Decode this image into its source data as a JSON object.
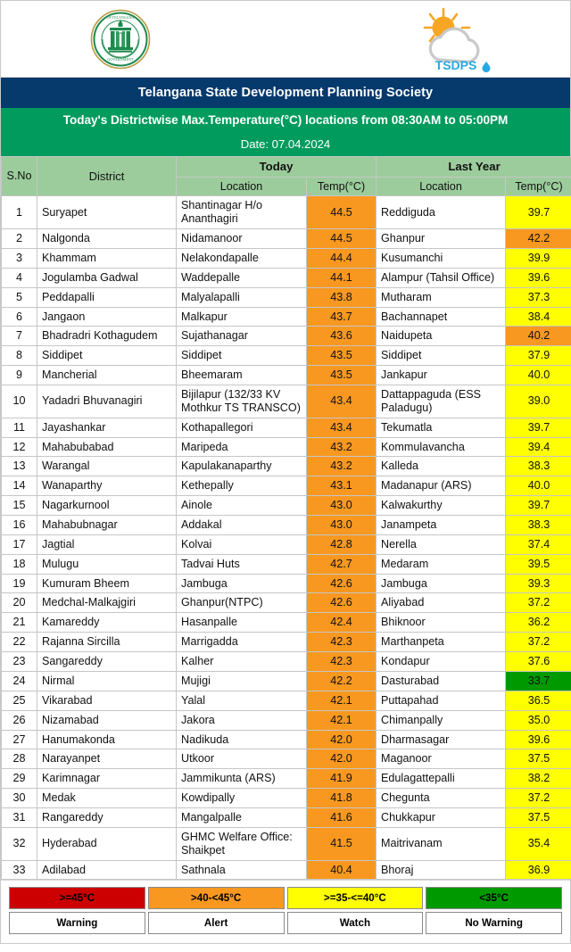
{
  "header": {
    "emblem_alt": "government-of-telangana-emblem",
    "logo_text": "TSDPS",
    "org_title": "Telangana State Development Planning Society",
    "subtitle": "Today's Districtwise Max.Temperature(°C) locations from 08:30AM to 05:00PM",
    "date_line": "Date: 07.04.2024"
  },
  "table": {
    "group_today": "Today",
    "group_last_year": "Last Year",
    "col_sno": "S.No",
    "col_district": "District",
    "col_location": "Location",
    "col_temp": "Temp(°C)",
    "col_location_ly": "Location",
    "col_temp_ly": "Temp(°C)",
    "rows": [
      {
        "sno": "1",
        "district": "Suryapet",
        "loc": "Shantinagar H/o Ananthagiri",
        "temp": "44.5",
        "sev": "alert",
        "loc_ly": "Reddiguda",
        "temp_ly": "39.7",
        "sev_ly": "watch"
      },
      {
        "sno": "2",
        "district": "Nalgonda",
        "loc": "Nidamanoor",
        "temp": "44.5",
        "sev": "alert",
        "loc_ly": "Ghanpur",
        "temp_ly": "42.2",
        "sev_ly": "alert"
      },
      {
        "sno": "3",
        "district": "Khammam",
        "loc": "Nelakondapalle",
        "temp": "44.4",
        "sev": "alert",
        "loc_ly": "Kusumanchi",
        "temp_ly": "39.9",
        "sev_ly": "watch"
      },
      {
        "sno": "4",
        "district": "Jogulamba Gadwal",
        "loc": "Waddepalle",
        "temp": "44.1",
        "sev": "alert",
        "loc_ly": "Alampur (Tahsil Office)",
        "temp_ly": "39.6",
        "sev_ly": "watch"
      },
      {
        "sno": "5",
        "district": "Peddapalli",
        "loc": "Malyalapalli",
        "temp": "43.8",
        "sev": "alert",
        "loc_ly": "Mutharam",
        "temp_ly": "37.3",
        "sev_ly": "watch"
      },
      {
        "sno": "6",
        "district": "Jangaon",
        "loc": "Malkapur",
        "temp": "43.7",
        "sev": "alert",
        "loc_ly": "Bachannapet",
        "temp_ly": "38.4",
        "sev_ly": "watch"
      },
      {
        "sno": "7",
        "district": "Bhadradri Kothagudem",
        "loc": "Sujathanagar",
        "temp": "43.6",
        "sev": "alert",
        "loc_ly": "Naidupeta",
        "temp_ly": "40.2",
        "sev_ly": "alert"
      },
      {
        "sno": "8",
        "district": "Siddipet",
        "loc": "Siddipet",
        "temp": "43.5",
        "sev": "alert",
        "loc_ly": "Siddipet",
        "temp_ly": "37.9",
        "sev_ly": "watch"
      },
      {
        "sno": "9",
        "district": "Mancherial",
        "loc": "Bheemaram",
        "temp": "43.5",
        "sev": "alert",
        "loc_ly": "Jankapur",
        "temp_ly": "40.0",
        "sev_ly": "watch"
      },
      {
        "sno": "10",
        "district": "Yadadri Bhuvanagiri",
        "loc": "Bijilapur (132/33 KV Mothkur TS TRANSCO)",
        "temp": "43.4",
        "sev": "alert",
        "loc_ly": "Dattappaguda (ESS Paladugu)",
        "temp_ly": "39.0",
        "sev_ly": "watch"
      },
      {
        "sno": "11",
        "district": "Jayashankar",
        "loc": "Kothapallegori",
        "temp": "43.4",
        "sev": "alert",
        "loc_ly": "Tekumatla",
        "temp_ly": "39.7",
        "sev_ly": "watch"
      },
      {
        "sno": "12",
        "district": "Mahabubabad",
        "loc": "Maripeda",
        "temp": "43.2",
        "sev": "alert",
        "loc_ly": "Kommulavancha",
        "temp_ly": "39.4",
        "sev_ly": "watch"
      },
      {
        "sno": "13",
        "district": "Warangal",
        "loc": "Kapulakanaparthy",
        "temp": "43.2",
        "sev": "alert",
        "loc_ly": "Kalleda",
        "temp_ly": "38.3",
        "sev_ly": "watch"
      },
      {
        "sno": "14",
        "district": "Wanaparthy",
        "loc": "Kethepally",
        "temp": "43.1",
        "sev": "alert",
        "loc_ly": "Madanapur (ARS)",
        "temp_ly": "40.0",
        "sev_ly": "watch"
      },
      {
        "sno": "15",
        "district": "Nagarkurnool",
        "loc": "Ainole",
        "temp": "43.0",
        "sev": "alert",
        "loc_ly": "Kalwakurthy",
        "temp_ly": "39.7",
        "sev_ly": "watch"
      },
      {
        "sno": "16",
        "district": "Mahabubnagar",
        "loc": "Addakal",
        "temp": "43.0",
        "sev": "alert",
        "loc_ly": "Janampeta",
        "temp_ly": "38.3",
        "sev_ly": "watch"
      },
      {
        "sno": "17",
        "district": "Jagtial",
        "loc": "Kolvai",
        "temp": "42.8",
        "sev": "alert",
        "loc_ly": "Nerella",
        "temp_ly": "37.4",
        "sev_ly": "watch"
      },
      {
        "sno": "18",
        "district": "Mulugu",
        "loc": "Tadvai Huts",
        "temp": "42.7",
        "sev": "alert",
        "loc_ly": "Medaram",
        "temp_ly": "39.5",
        "sev_ly": "watch"
      },
      {
        "sno": "19",
        "district": "Kumuram Bheem",
        "loc": "Jambuga",
        "temp": "42.6",
        "sev": "alert",
        "loc_ly": "Jambuga",
        "temp_ly": "39.3",
        "sev_ly": "watch"
      },
      {
        "sno": "20",
        "district": "Medchal-Malkajgiri",
        "loc": "Ghanpur(NTPC)",
        "temp": "42.6",
        "sev": "alert",
        "loc_ly": "Aliyabad",
        "temp_ly": "37.2",
        "sev_ly": "watch"
      },
      {
        "sno": "21",
        "district": "Kamareddy",
        "loc": "Hasanpalle",
        "temp": "42.4",
        "sev": "alert",
        "loc_ly": "Bhiknoor",
        "temp_ly": "36.2",
        "sev_ly": "watch"
      },
      {
        "sno": "22",
        "district": "Rajanna Sircilla",
        "loc": "Marrigadda",
        "temp": "42.3",
        "sev": "alert",
        "loc_ly": "Marthanpeta",
        "temp_ly": "37.2",
        "sev_ly": "watch"
      },
      {
        "sno": "23",
        "district": "Sangareddy",
        "loc": "Kalher",
        "temp": "42.3",
        "sev": "alert",
        "loc_ly": "Kondapur",
        "temp_ly": "37.6",
        "sev_ly": "watch"
      },
      {
        "sno": "24",
        "district": "Nirmal",
        "loc": "Mujigi",
        "temp": "42.2",
        "sev": "alert",
        "loc_ly": "Dasturabad",
        "temp_ly": "33.7",
        "sev_ly": "nowarning"
      },
      {
        "sno": "25",
        "district": "Vikarabad",
        "loc": "Yalal",
        "temp": "42.1",
        "sev": "alert",
        "loc_ly": "Puttapahad",
        "temp_ly": "36.5",
        "sev_ly": "watch"
      },
      {
        "sno": "26",
        "district": "Nizamabad",
        "loc": "Jakora",
        "temp": "42.1",
        "sev": "alert",
        "loc_ly": "Chimanpally",
        "temp_ly": "35.0",
        "sev_ly": "watch"
      },
      {
        "sno": "27",
        "district": "Hanumakonda",
        "loc": "Nadikuda",
        "temp": "42.0",
        "sev": "alert",
        "loc_ly": "Dharmasagar",
        "temp_ly": "39.6",
        "sev_ly": "watch"
      },
      {
        "sno": "28",
        "district": "Narayanpet",
        "loc": "Utkoor",
        "temp": "42.0",
        "sev": "alert",
        "loc_ly": "Maganoor",
        "temp_ly": "37.5",
        "sev_ly": "watch"
      },
      {
        "sno": "29",
        "district": "Karimnagar",
        "loc": "Jammikunta (ARS)",
        "temp": "41.9",
        "sev": "alert",
        "loc_ly": "Edulagattepalli",
        "temp_ly": "38.2",
        "sev_ly": "watch"
      },
      {
        "sno": "30",
        "district": "Medak",
        "loc": "Kowdipally",
        "temp": "41.8",
        "sev": "alert",
        "loc_ly": "Chegunta",
        "temp_ly": "37.2",
        "sev_ly": "watch"
      },
      {
        "sno": "31",
        "district": "Rangareddy",
        "loc": "Mangalpalle",
        "temp": "41.6",
        "sev": "alert",
        "loc_ly": "Chukkapur",
        "temp_ly": "37.5",
        "sev_ly": "watch"
      },
      {
        "sno": "32",
        "district": "Hyderabad",
        "loc": "GHMC Welfare Office: Shaikpet",
        "temp": "41.5",
        "sev": "alert",
        "loc_ly": "Maitrivanam",
        "temp_ly": "35.4",
        "sev_ly": "watch"
      },
      {
        "sno": "33",
        "district": "Adilabad",
        "loc": "Sathnala",
        "temp": "40.4",
        "sev": "alert",
        "loc_ly": "Bhoraj",
        "temp_ly": "36.9",
        "sev_ly": "watch"
      }
    ]
  },
  "legend": {
    "ranges": [
      {
        "range": ">=45°C",
        "label": "Warning",
        "sev": "warning"
      },
      {
        "range": ">40-<45°C",
        "label": "Alert",
        "sev": "alert"
      },
      {
        "range": ">=35-<=40°C",
        "label": "Watch",
        "sev": "watch"
      },
      {
        "range": "<35°C",
        "label": "No Warning",
        "sev": "nowarning"
      }
    ]
  },
  "colors": {
    "banner_blue": "#06396c",
    "banner_green": "#009b5d",
    "header_green": "#9ccc9c",
    "warning": "#cc0000",
    "alert": "#f89820",
    "watch": "#ffff00",
    "nowarning": "#009900"
  }
}
